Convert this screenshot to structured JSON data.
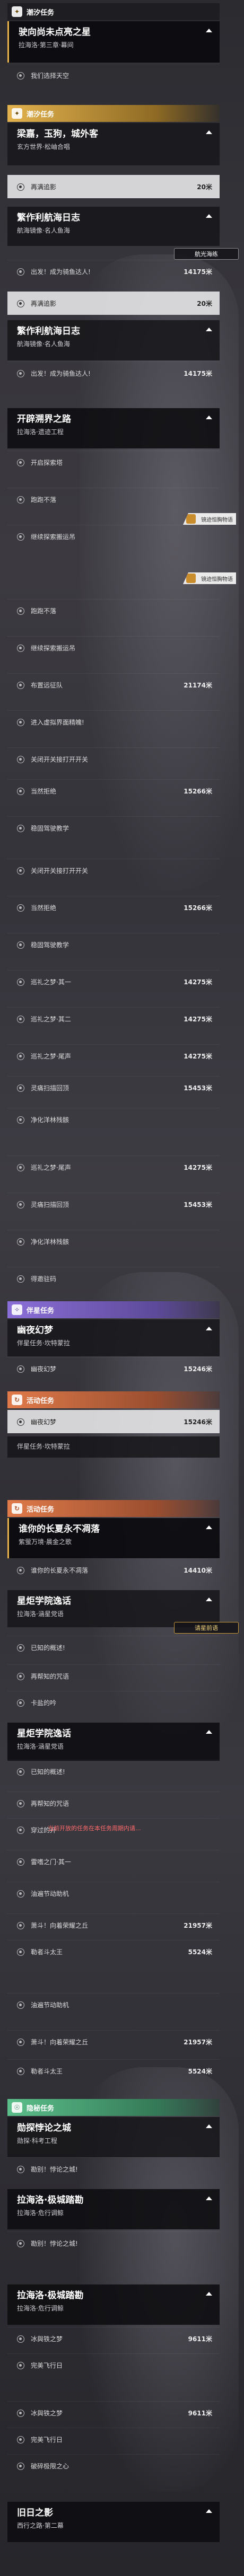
{
  "categories": {
    "c1": "潮汐任务",
    "c2": "潮汐任务",
    "c3": "伴星任务",
    "c4": "活动任务",
    "c5": "活动任务",
    "c6": "隐秘任务"
  },
  "quests": {
    "q1": {
      "name": "驶向尚未点亮之星",
      "sub": "拉海洛·第三章·幕间"
    },
    "q2": {
      "name": "梁嘉，玉狗，城外客",
      "sub": "玄方世界·松岫合唱"
    },
    "q3": {
      "name": "繁作利航海日志",
      "sub": "航海镜像·名人鱼海"
    },
    "q4": {
      "name": "繁作利航海日志",
      "sub": "航海镜像·名人鱼海"
    },
    "q5": {
      "name": "开辟溯界之路",
      "sub": "拉海洛·遗迹工程"
    },
    "q6": {
      "name": "幽夜幻梦",
      "sub": "伴星任务·坎特蒙拉"
    },
    "q7": {
      "name": "伴星任务·坎特蒙拉"
    },
    "q8": {
      "name": "谁你的长夏永不凋落",
      "sub": "紫萤万境·晨金之歌"
    },
    "q9": {
      "name": "星炬学院逸话",
      "sub": "拉海洛·涵星党语"
    },
    "q10": {
      "name": "星炬学院逸话",
      "sub": "拉海洛·涵星党语"
    },
    "q11": {
      "name": "勋探悖论之城",
      "sub": "勋探·科考工程"
    },
    "q12": {
      "name": "拉海洛·极城踏勘",
      "sub": "拉海洛·危行调鲸"
    },
    "q13": {
      "name": "拉海洛·极城踏勘",
      "sub": "拉海洛·危行调鲸"
    },
    "q14": {
      "name": "旧日之影",
      "sub": "西行之路·第二幕"
    }
  },
  "rows": [
    {
      "text": "我们选择天空",
      "dist": ""
    },
    {
      "text": "再满追影",
      "dist": "20米"
    },
    {
      "text": "出发！成为骑鱼达人!",
      "dist": "14175米"
    },
    {
      "text": "再满追影",
      "dist": "20米"
    },
    {
      "text": "出发！成为骑鱼达人!",
      "dist": "14175米"
    },
    {
      "text": "开启探索塔",
      "dist": ""
    },
    {
      "text": "跑跑不落",
      "dist": ""
    },
    {
      "text": "继续探索搬运吊",
      "dist": ""
    },
    {
      "text": "跑跑不落",
      "dist": ""
    },
    {
      "text": "继续探索搬运吊",
      "dist": ""
    },
    {
      "text": "布置远征队",
      "dist": "21174米"
    },
    {
      "text": "进入虚拟界面精魄!",
      "dist": ""
    },
    {
      "text": "关闭开关接打开开关",
      "dist": ""
    },
    {
      "text": "当然拒绝",
      "dist": "15266米"
    },
    {
      "text": "稳固驾驶教学",
      "dist": ""
    },
    {
      "text": "关闭开关接打开开关",
      "dist": ""
    },
    {
      "text": "当然拒绝",
      "dist": "15266米"
    },
    {
      "text": "稳固驾驶教学",
      "dist": ""
    },
    {
      "text": "巡礼之梦·其一",
      "dist": "14275米"
    },
    {
      "text": "巡礼之梦·其二",
      "dist": "14275米"
    },
    {
      "text": "巡礼之梦·尾声",
      "dist": "14275米"
    },
    {
      "text": "灵痛扫描回顶",
      "dist": "15453米"
    },
    {
      "text": "净化洋林残骸",
      "dist": ""
    },
    {
      "text": "巡礼之梦·尾声",
      "dist": "14275米"
    },
    {
      "text": "灵痛扫描回顶",
      "dist": "15453米"
    },
    {
      "text": "净化洋林残骸",
      "dist": ""
    },
    {
      "text": "得邀驻码",
      "dist": ""
    },
    {
      "text": "幽夜幻梦",
      "dist": "15246米"
    },
    {
      "text": "幽夜幻梦",
      "dist": "15246米"
    },
    {
      "text": "谁你的长夏永不凋落",
      "dist": "14410米"
    },
    {
      "text": "已知的概述!",
      "dist": ""
    },
    {
      "text": "再帮知的咒语",
      "dist": ""
    },
    {
      "text": "卡盐的吟",
      "dist": ""
    },
    {
      "text": "已知的概述!",
      "dist": ""
    },
    {
      "text": "再帮知的咒语",
      "dist": ""
    },
    {
      "text": "穿过的开",
      "dist": ""
    },
    {
      "text": "雷嗜之门·其一",
      "dist": ""
    },
    {
      "text": "油遍节动助机",
      "dist": ""
    },
    {
      "text": "萧斗！向着荣耀之丘",
      "dist": "21957米"
    },
    {
      "text": "勒者斗太王",
      "dist": "5524米"
    },
    {
      "text": "油遍节动助机",
      "dist": ""
    },
    {
      "text": "萧斗！向着荣耀之丘",
      "dist": "21957米"
    },
    {
      "text": "勒者斗太王",
      "dist": "5524米"
    },
    {
      "text": "勘别！悖论之城!",
      "dist": ""
    },
    {
      "text": "勘别！悖论之城!",
      "dist": ""
    },
    {
      "text": "冰與铁之梦",
      "dist": "9611米"
    },
    {
      "text": "完美飞行日",
      "dist": ""
    },
    {
      "text": "冰與铁之梦",
      "dist": "9611米"
    },
    {
      "text": "完美飞行日",
      "dist": ""
    },
    {
      "text": "破碎极限之心",
      "dist": ""
    }
  ],
  "buttons": {
    "track": "航光海练",
    "track_alt": "请星前语",
    "scene": "镜迹恒胸物语"
  },
  "tips": {
    "red": "当前开放的任务在本任务周期内请..."
  }
}
